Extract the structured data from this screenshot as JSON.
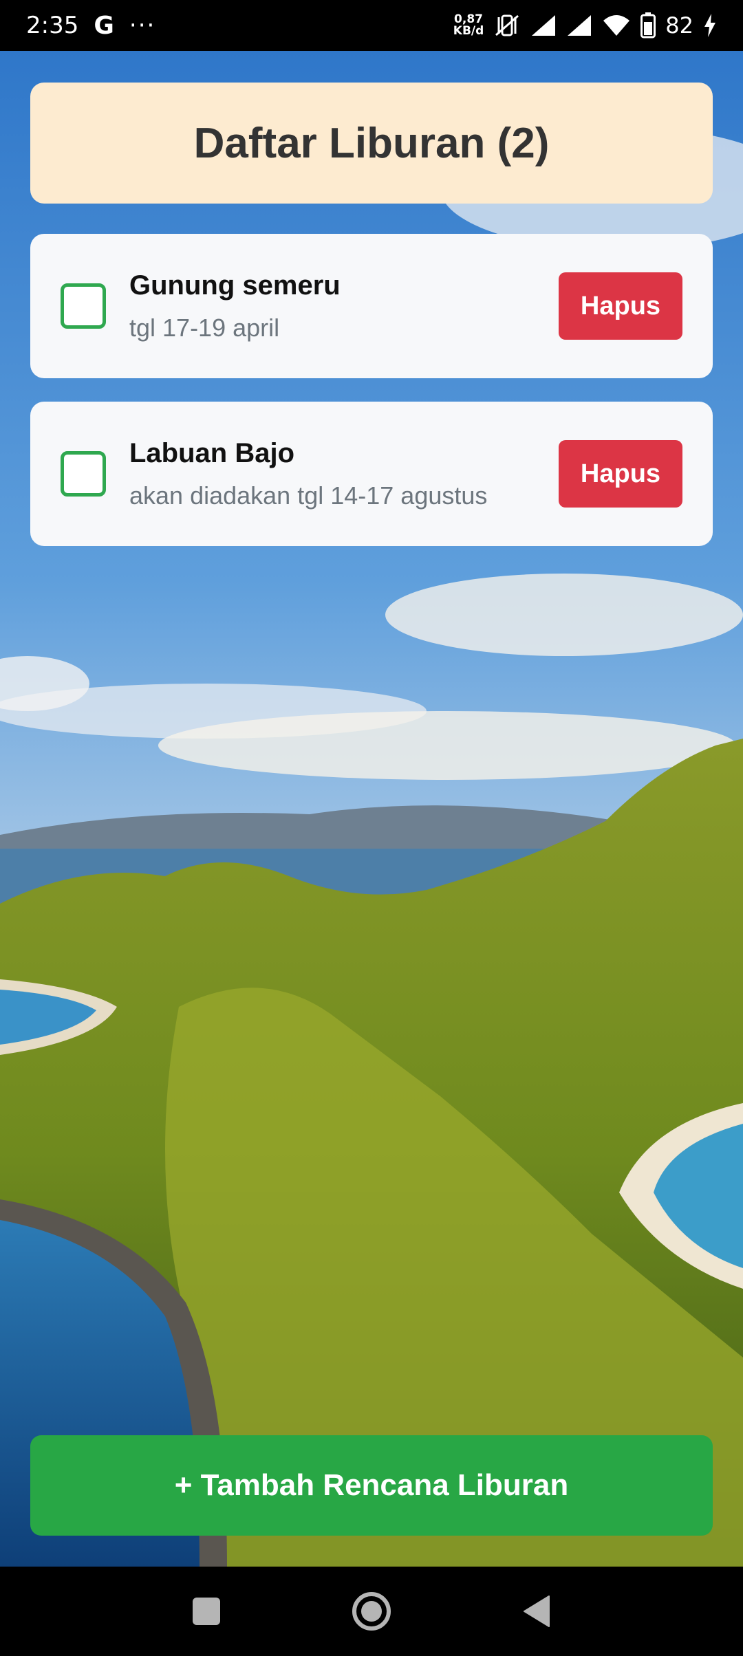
{
  "status_bar": {
    "time": "2:35",
    "google_icon": "G",
    "more": "···",
    "net_speed_value": "0,87",
    "net_speed_unit": "KB/d",
    "battery_percent": "82"
  },
  "header": {
    "title": "Daftar Liburan (2)"
  },
  "items": [
    {
      "title": "Gunung semeru",
      "description": "tgl 17-19 april",
      "delete_label": "Hapus"
    },
    {
      "title": "Labuan Bajo",
      "description": "akan diadakan tgl 14-17 agustus",
      "delete_label": "Hapus"
    }
  ],
  "add_button": {
    "label": "+ Tambah Rencana Liburan"
  },
  "colors": {
    "header_bg": "#fdebd0",
    "checkbox_border": "#2fa84f",
    "delete_button": "#dc3545",
    "add_button": "#28a745"
  },
  "nav": {
    "icons": [
      "recents-icon",
      "home-icon",
      "back-icon"
    ]
  }
}
